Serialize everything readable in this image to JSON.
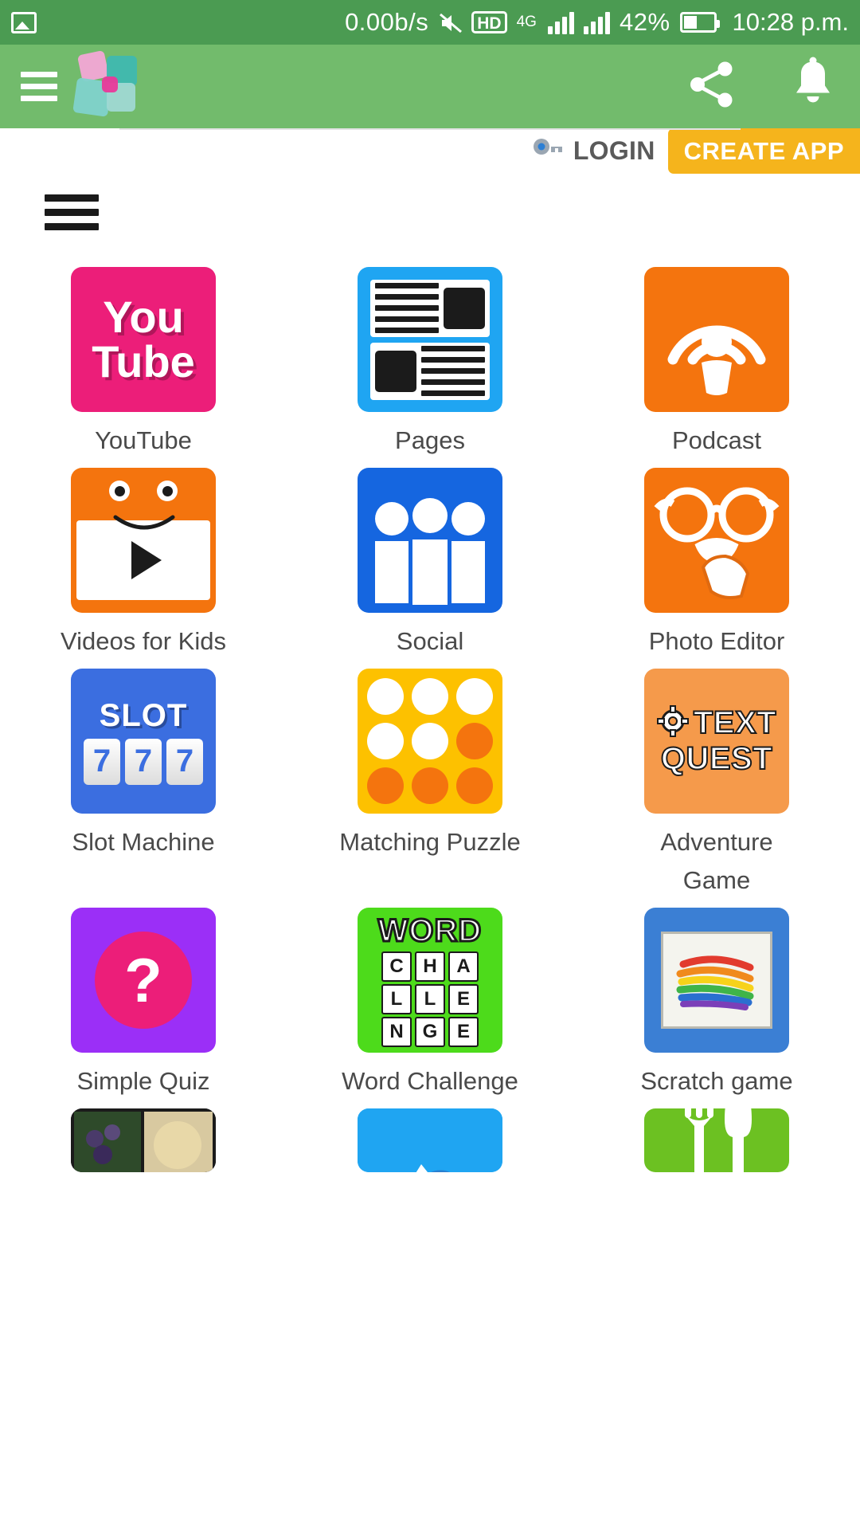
{
  "status_bar": {
    "icons": [
      "image-icon",
      "mute-icon",
      "hd-icon",
      "signal-4g-icon",
      "signal-icon",
      "battery-icon"
    ],
    "network_speed": "0.00b/s",
    "hd_label": "HD",
    "network_type": "4G",
    "battery_percent": "42%",
    "clock": "10:28 p.m."
  },
  "app_bar": {
    "menu_icon": "hamburger-icon",
    "logo": "app-logo",
    "share_icon": "share-icon",
    "bell_icon": "notification-bell-icon",
    "background": "#72bb6c"
  },
  "web_header": {
    "key_icon": "key-icon",
    "login_label": "LOGIN",
    "create_app_label": "CREATE APP",
    "create_app_color": "#f5b41c",
    "menu_icon": "hamburger-icon"
  },
  "grid": {
    "items": [
      {
        "label": "YouTube",
        "tile": "youtube",
        "color": "#ec1e79",
        "text_top": "You",
        "text_bottom": "Tube"
      },
      {
        "label": "Pages",
        "tile": "pages",
        "color": "#1fa5f2"
      },
      {
        "label": "Podcast",
        "tile": "podcast",
        "color": "#f4740e"
      },
      {
        "label": "Videos for Kids",
        "tile": "videos-kids",
        "color": "#f4740e"
      },
      {
        "label": "Social",
        "tile": "social",
        "color": "#1566e0"
      },
      {
        "label": "Photo Editor",
        "tile": "photo-editor",
        "color": "#f4740e"
      },
      {
        "label": "Slot Machine",
        "tile": "slot-machine",
        "color": "#3b6ee0",
        "word": "SLOT",
        "reels": [
          "7",
          "7",
          "7"
        ]
      },
      {
        "label": "Matching Puzzle",
        "tile": "matching",
        "color": "#fdc100"
      },
      {
        "label": "Adventure Game",
        "tile": "text-quest",
        "color": "#f59a4b",
        "word1": "TEXT",
        "word2": "QUEST"
      },
      {
        "label": "Simple Quiz",
        "tile": "simple-quiz",
        "color": "#9b2ff7",
        "glyph": "?"
      },
      {
        "label": "Word Challenge",
        "tile": "word-challenge",
        "color": "#4ddb1b",
        "word": "WORD",
        "row1": [
          "C",
          "H",
          "A"
        ],
        "row2": [
          "L",
          "L",
          "E"
        ],
        "row3": [
          "N",
          "G",
          "E"
        ]
      },
      {
        "label": "Scratch game",
        "tile": "scratch",
        "color": "#3b7fd4"
      },
      {
        "label": "",
        "tile": "food-photos",
        "color": "#1b1b1b"
      },
      {
        "label": "",
        "tile": "blue-camera",
        "color": "#1fa5f2"
      },
      {
        "label": "",
        "tile": "restaurant",
        "color": "#6cc122"
      }
    ]
  }
}
